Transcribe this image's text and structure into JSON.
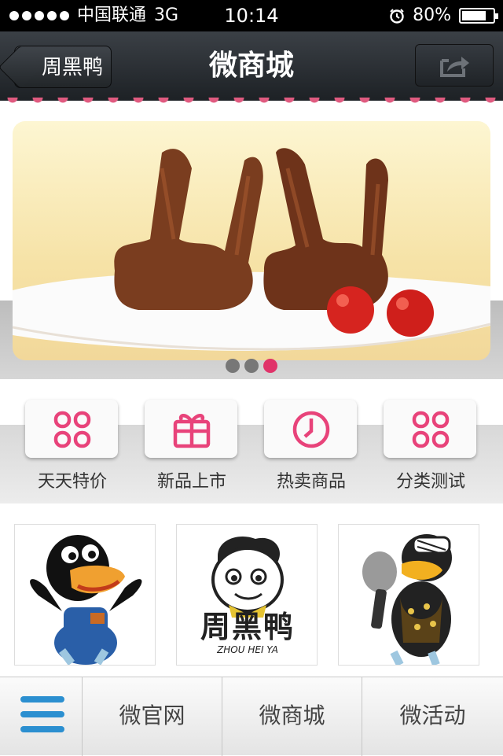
{
  "status_bar": {
    "carrier": "中国联通",
    "network": "3G",
    "time": "10:14",
    "battery": "80%",
    "battery_level": 0.8
  },
  "nav": {
    "back_label": "周黑鸭",
    "title": "微商城"
  },
  "banner": {
    "slide_count": 3,
    "active_slide": 3
  },
  "quick_menu": [
    {
      "label": "天天特价",
      "icon": "grid-icon"
    },
    {
      "label": "新品上市",
      "icon": "gift-icon"
    },
    {
      "label": "热卖商品",
      "icon": "clock-icon"
    },
    {
      "label": "分类测试",
      "icon": "grid-icon"
    }
  ],
  "products": {
    "logo_text": "周黑鸭",
    "logo_subtext": "ZHOU HEI YA"
  },
  "tabbar": {
    "menu_icon": "hamburger-icon",
    "tabs": [
      "微官网",
      "微商城",
      "微活动"
    ]
  },
  "colors": {
    "accent": "#e0336a",
    "menu_blue": "#2b8fd0",
    "nav_dark": "#1d2125"
  }
}
